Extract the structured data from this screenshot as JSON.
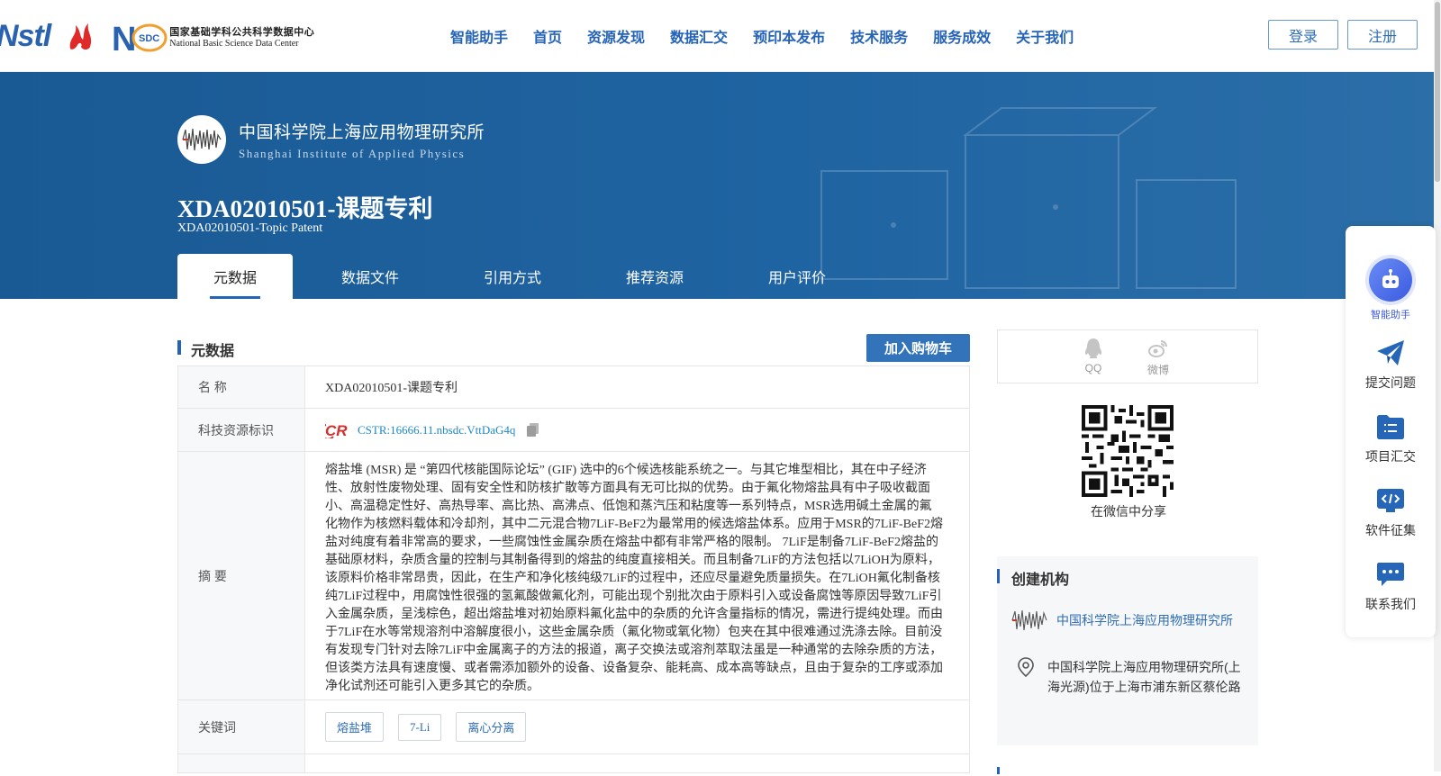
{
  "header": {
    "logos": {
      "nstl": "Nstl",
      "nsdc_cn": "国家基础学科公共科学数据中心",
      "nsdc_en": "National Basic Science Data Center",
      "nsdc_mark": "SDC"
    },
    "nav": [
      "智能助手",
      "首页",
      "资源发现",
      "数据汇交",
      "预印本发布",
      "技术服务",
      "服务成效",
      "关于我们"
    ],
    "login": "登录",
    "register": "注册"
  },
  "banner": {
    "institution_cn": "中国科学院上海应用物理研究所",
    "institution_en": "Shanghai Institute of Applied Physics",
    "title_cn": "XDA02010501-课题专利",
    "title_en": "XDA02010501-Topic Patent",
    "tabs": [
      "元数据",
      "数据文件",
      "引用方式",
      "推荐资源",
      "用户评价"
    ],
    "active_tab": 0
  },
  "metadata": {
    "section_title": "元数据",
    "cart_button": "加入购物车",
    "rows": {
      "name_label": "名 称",
      "name_value": "XDA02010501-课题专利",
      "id_label": "科技资源标识",
      "id_value": "CSTR:16666.11.nbsdc.VttDaG4q",
      "abstract_label": "摘 要",
      "abstract_value": "熔盐堆 (MSR) 是 “第四代核能国际论坛” (GIF) 选中的6个候选核能系统之一。与其它堆型相比，其在中子经济性、放射性废物处理、固有安全性和防核扩散等方面具有无可比拟的优势。由于氟化物熔盐具有中子吸收截面小、高温稳定性好、高热导率、高比热、高沸点、低饱和蒸汽压和粘度等一系列特点，MSR选用碱土金属的氟化物作为核燃料载体和冷却剂，其中二元混合物7LiF-BeF2为最常用的候选熔盐体系。应用于MSR的7LiF-BeF2熔盐对纯度有着非常高的要求，一些腐蚀性金属杂质在熔盐中都有非常严格的限制。 7LiF是制备7LiF-BeF2熔盐的基础原材料，杂质含量的控制与其制备得到的熔盐的纯度直接相关。而且制备7LiF的方法包括以7LiOH为原料，该原料价格非常昂贵，因此，在生产和净化核纯级7LiF的过程中，还应尽量避免质量损失。在7LiOH氟化制备核纯7LiF过程中，用腐蚀性很强的氢氟酸做氟化剂，可能出现个别批次由于原料引入或设备腐蚀等原因导致7LiF引入金属杂质，呈浅棕色，超出熔盐堆对初始原料氟化盐中的杂质的允许含量指标的情况，需进行提纯处理。而由于7LiF在水等常规溶剂中溶解度很小，这些金属杂质（氟化物或氧化物）包夹在其中很难通过洗涤去除。目前没有发现专门针对去除7LiF中金属离子的方法的报道，离子交换法或溶剂萃取法虽是一种通常的去除杂质的方法，但该类方法具有速度慢、或者需添加额外的设备、设备复杂、能耗高、成本高等缺点，且由于复杂的工序或添加净化试剂还可能引入更多其它的杂质。",
      "keywords_label": "关键词",
      "keywords": [
        "熔盐堆",
        "7-Li",
        "离心分离"
      ]
    }
  },
  "share": {
    "qq": "QQ",
    "weibo": "微博",
    "wechat_caption": "在微信中分享"
  },
  "org": {
    "title": "创建机构",
    "name": "中国科学院上海应用物理研究所",
    "address": "中国科学院上海应用物理研究所(上海光源)位于上海市浦东新区蔡伦路"
  },
  "float_panel": {
    "items": [
      "智能助手",
      "提交问题",
      "项目汇交",
      "软件征集",
      "联系我们"
    ]
  }
}
